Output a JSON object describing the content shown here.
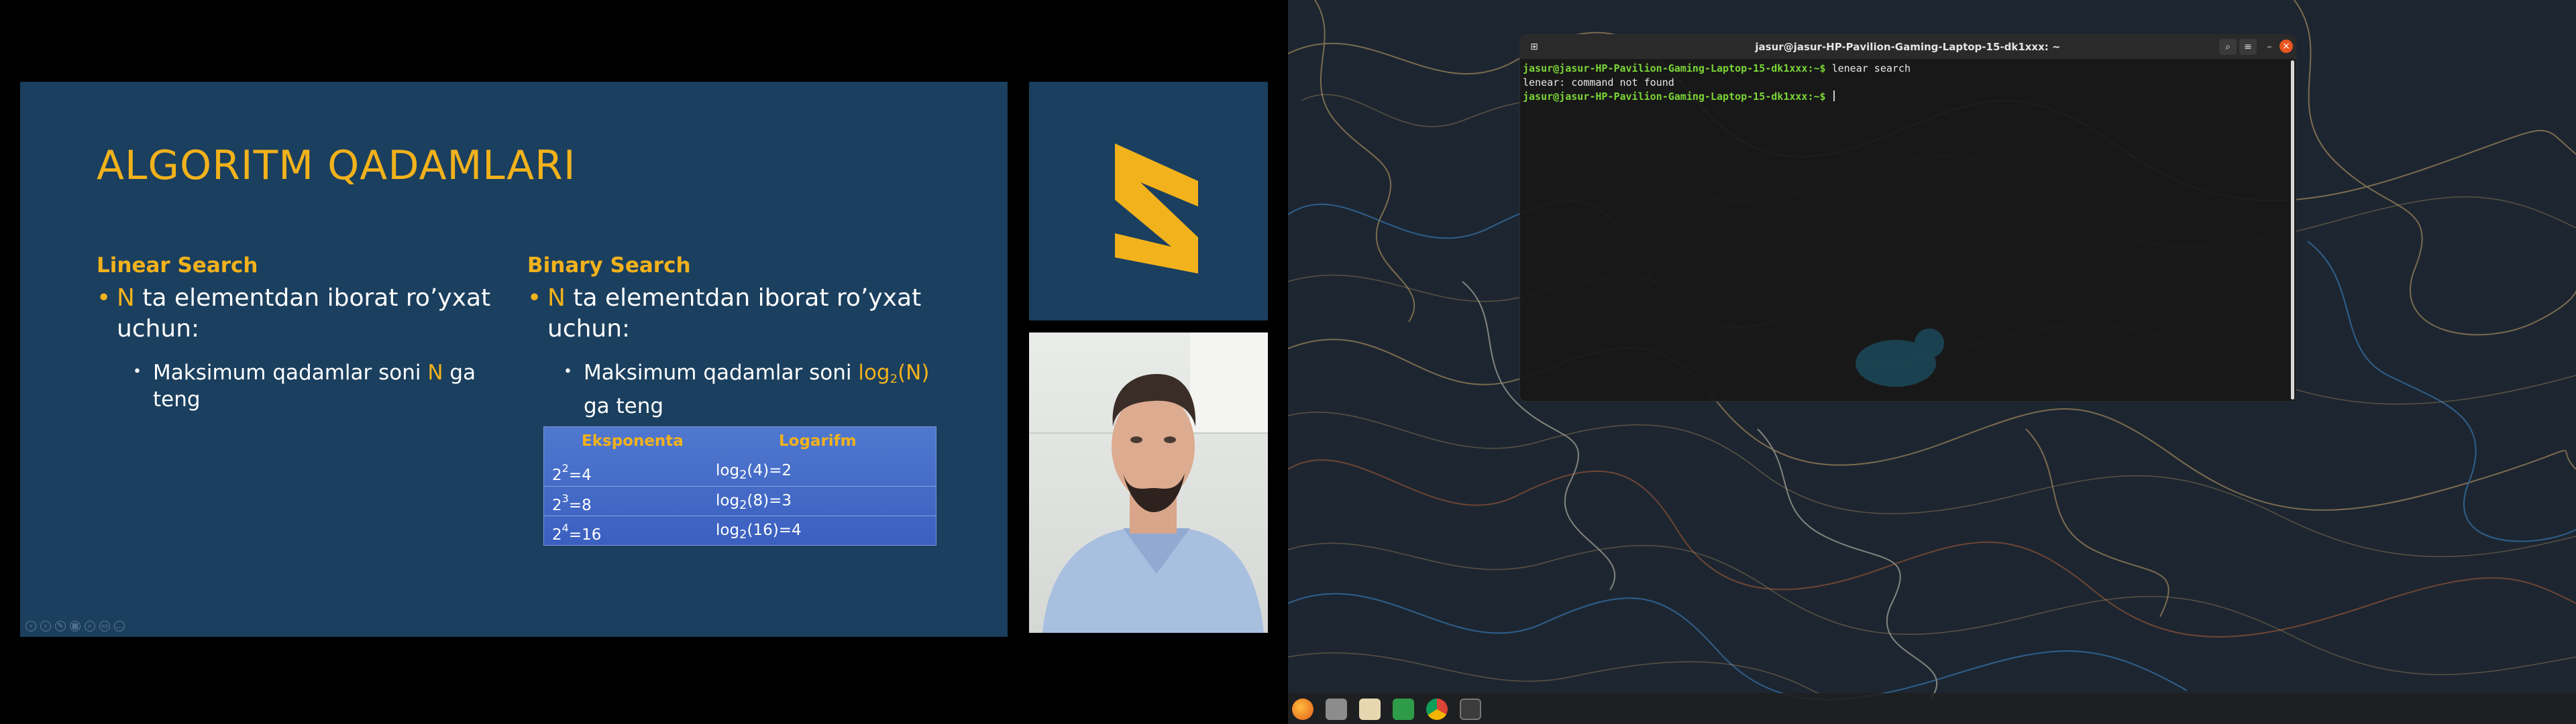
{
  "slide": {
    "title": "ALGORITM QADAMLARI",
    "linear": {
      "heading": "Linear Search",
      "bullet_n": "N",
      "bullet_rest": " ta elementdan iborat ro’yxat uchun:",
      "sub_pre": "Maksimum qadamlar soni ",
      "sub_n": "N",
      "sub_post": " ga teng"
    },
    "binary": {
      "heading": "Binary Search",
      "bullet_n": "N",
      "bullet_rest": " ta elementdan iborat ro’yxat uchun:",
      "sub_pre": "Maksimum qadamlar soni ",
      "sub_log": "log",
      "sub_base": "2",
      "sub_arg": "(N)",
      "sub_post": "ga teng"
    },
    "table": {
      "col1": "Eksponenta",
      "col2": "Logarifm",
      "rows": [
        {
          "base": "2",
          "exp": "2",
          "res": "=4",
          "log": "log",
          "sub": "2",
          "arg": "(4)=2"
        },
        {
          "base": "2",
          "exp": "3",
          "res": "=8",
          "log": "log",
          "sub": "2",
          "arg": "(8)=3"
        },
        {
          "base": "2",
          "exp": "4",
          "res": "=16",
          "log": "log",
          "sub": "2",
          "arg": "(16)=4"
        }
      ]
    },
    "accent_color": "#f2b21c",
    "background_color": "#1b3f5e"
  },
  "terminal": {
    "title": "jasur@jasur-HP-Pavilion-Gaming-Laptop-15-dk1xxx: ~",
    "lines": [
      {
        "prompt": "jasur@jasur-HP-Pavilion-Gaming-Laptop-15-dk1xxx:~$",
        "cmd": " lenear search"
      },
      {
        "output": "lenear: command not found"
      },
      {
        "prompt": "jasur@jasur-HP-Pavilion-Gaming-Laptop-15-dk1xxx:~$",
        "cmd": " "
      }
    ],
    "buttons": {
      "new_tab": "new-tab-icon",
      "search": "search-icon",
      "menu": "hamburger-icon",
      "minimize": "–",
      "maximize": "□",
      "close": "×"
    }
  },
  "taskbar": {
    "apps": [
      "firefox-icon",
      "file-manager-icon",
      "text-editor-icon",
      "spreadsheet-icon",
      "chrome-icon",
      "terminal-icon"
    ]
  }
}
